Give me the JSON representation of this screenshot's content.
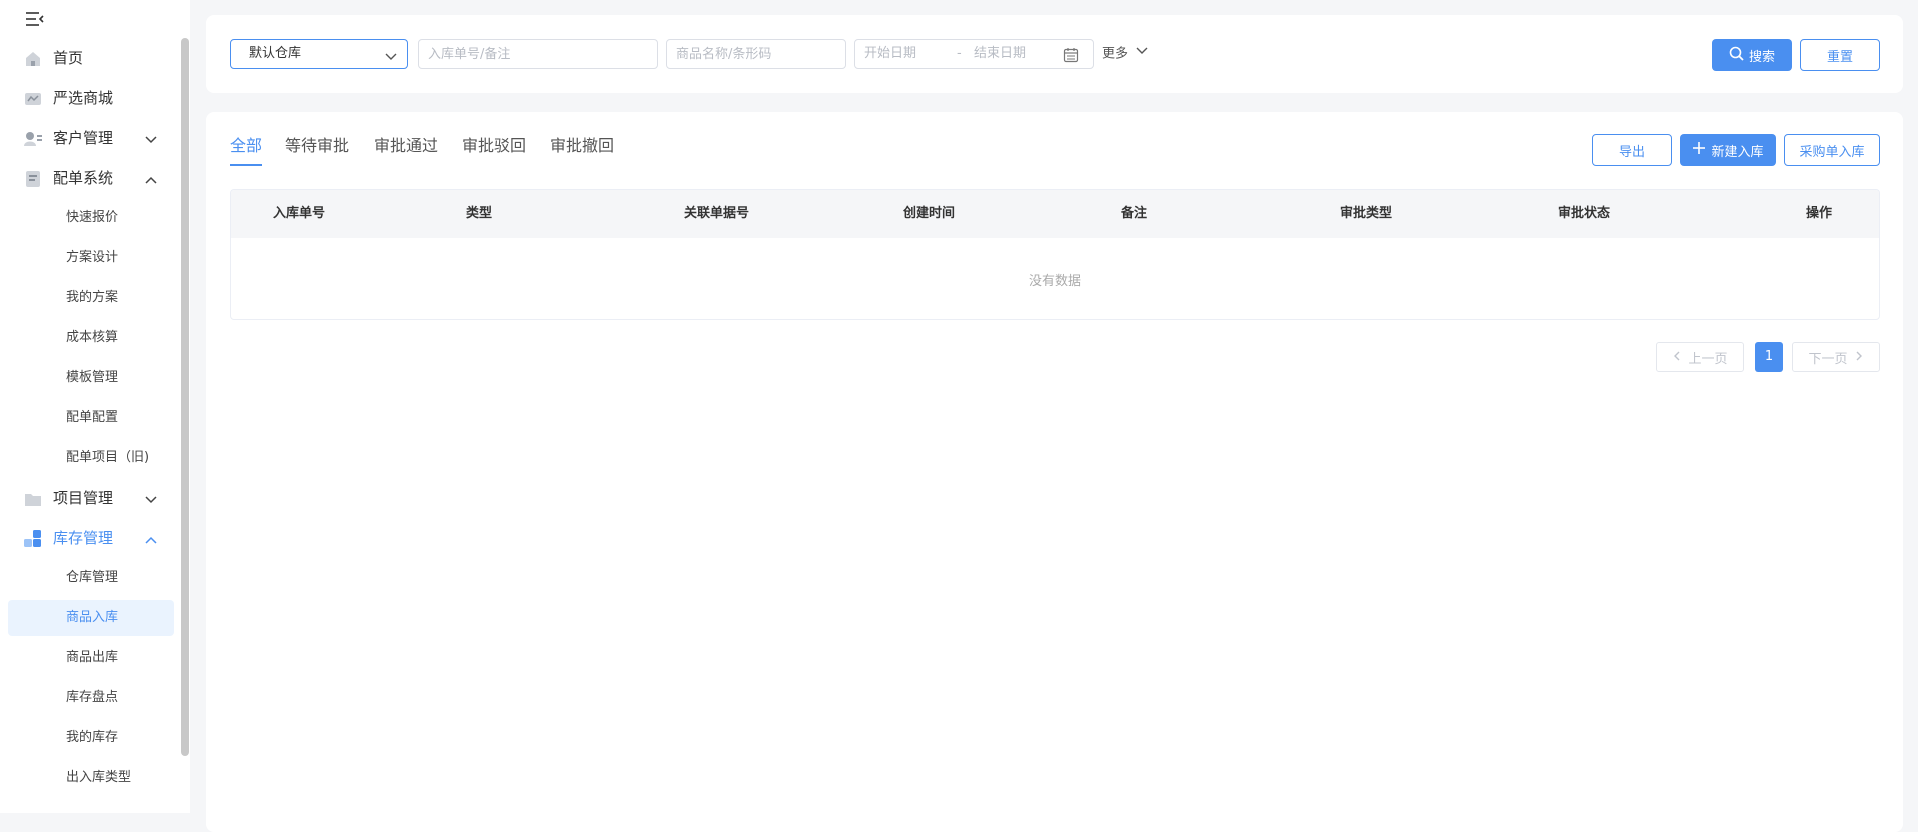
{
  "sidebar": {
    "items": [
      {
        "label": "首页",
        "icon": "home-icon"
      },
      {
        "label": "严选商城",
        "icon": "mall-icon"
      },
      {
        "label": "客户管理",
        "icon": "customer-icon",
        "expanded": false
      },
      {
        "label": "配单系统",
        "icon": "document-icon",
        "expanded": true
      },
      {
        "label": "项目管理",
        "icon": "folder-icon",
        "expanded": false
      },
      {
        "label": "库存管理",
        "icon": "inventory-icon",
        "expanded": true,
        "active": true
      }
    ],
    "order_sub": [
      "快速报价",
      "方案设计",
      "我的方案",
      "成本核算",
      "模板管理",
      "配单配置",
      "配单项目（旧)"
    ],
    "inventory_sub": [
      "仓库管理",
      "商品入库",
      "商品出库",
      "库存盘点",
      "我的库存",
      "出入库类型"
    ],
    "selected": "商品入库"
  },
  "filter": {
    "warehouse": "默认仓库",
    "inbound_placeholder": "入库单号/备注",
    "product_placeholder": "商品名称/条形码",
    "start_placeholder": "开始日期",
    "date_sep": "-",
    "end_placeholder": "结束日期",
    "more": "更多",
    "search": "搜索",
    "reset": "重置"
  },
  "tabs": [
    "全部",
    "等待审批",
    "审批通过",
    "审批驳回",
    "审批撤回"
  ],
  "actions": {
    "export": "导出",
    "new": "新建入库",
    "purchase": "采购单入库"
  },
  "table": {
    "columns": [
      "入库单号",
      "类型",
      "关联单据号",
      "创建时间",
      "备注",
      "审批类型",
      "审批状态",
      "操作"
    ],
    "rows": [],
    "empty": "没有数据"
  },
  "pagination": {
    "prev": "上一页",
    "page": "1",
    "next": "下一页"
  },
  "colors": {
    "accent": "#4a8ff0",
    "background": "#f5f6f8"
  }
}
